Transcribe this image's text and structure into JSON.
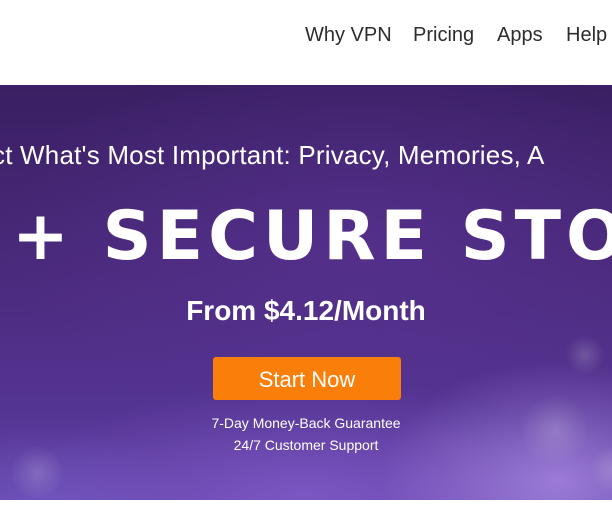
{
  "nav": {
    "items": [
      {
        "label": "Why VPN"
      },
      {
        "label": "Pricing"
      },
      {
        "label": "Apps"
      },
      {
        "label": "Help"
      }
    ]
  },
  "hero": {
    "tagline": "ct What's Most Important: Privacy, Memories, A",
    "headline": "+ SECURE STOR",
    "price": "From $4.12/Month",
    "cta_label": "Start Now",
    "guarantee": "7-Day Money-Back Guarantee",
    "support": "24/7 Customer Support"
  },
  "colors": {
    "cta": "#fa7f0a",
    "hero_bg": "#4a2a7c",
    "nav_text": "#2d2d2d"
  }
}
